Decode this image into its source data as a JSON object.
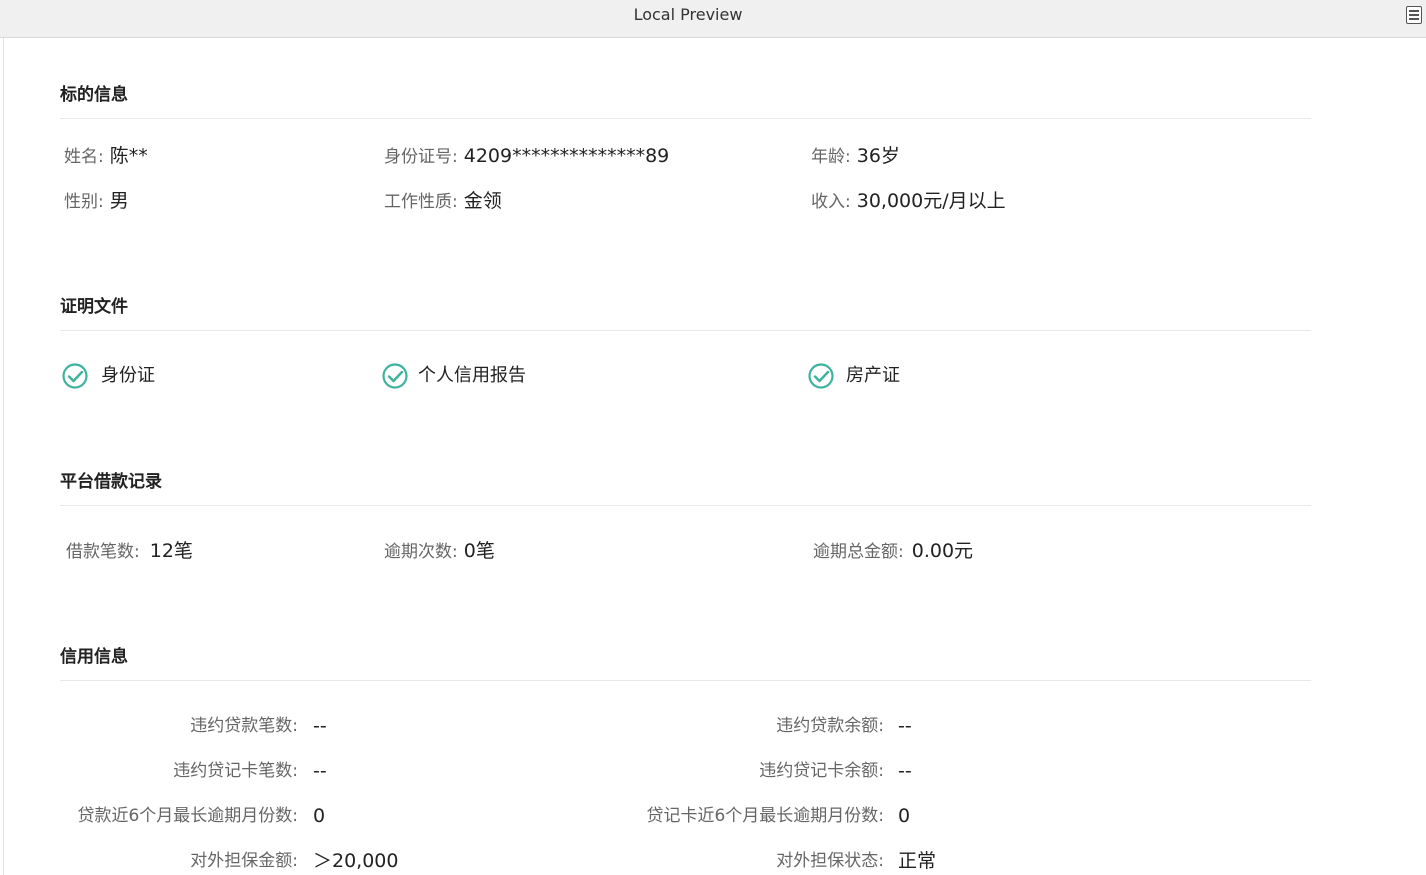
{
  "window": {
    "title": "Local Preview",
    "menu_icon": "document-menu-icon"
  },
  "sections": {
    "target_info": {
      "title": "标的信息",
      "fields": [
        {
          "label": "姓名:",
          "value": "陈**"
        },
        {
          "label": "身份证号:",
          "value": "4209**************89"
        },
        {
          "label": "年龄:",
          "value": "36岁"
        },
        {
          "label": "性别:",
          "value": "男"
        },
        {
          "label": "工作性质:",
          "value": "金领"
        },
        {
          "label": "收入:",
          "value": "30,000元/月以上"
        }
      ]
    },
    "documents": {
      "title": "证明文件",
      "items": [
        {
          "label": "身份证",
          "icon": "check-circle-icon"
        },
        {
          "label": "个人信用报告",
          "icon": "check-circle-icon"
        },
        {
          "label": "房产证",
          "icon": "check-circle-icon"
        }
      ],
      "check_color": "#3db39e"
    },
    "loan_record": {
      "title": "平台借款记录",
      "fields": [
        {
          "label": "借款笔数:",
          "value": "12笔"
        },
        {
          "label": "逾期次数:",
          "value": "0笔"
        },
        {
          "label": "逾期总金额:",
          "value": "0.00元"
        }
      ]
    },
    "credit_info": {
      "title": "信用信息",
      "fields": [
        {
          "label": "违约贷款笔数:",
          "value": "--"
        },
        {
          "label": "违约贷款余额:",
          "value": "--"
        },
        {
          "label": "违约贷记卡笔数:",
          "value": "--"
        },
        {
          "label": "违约贷记卡余额:",
          "value": "--"
        },
        {
          "label": "贷款近6个月最长逾期月份数:",
          "value": "0"
        },
        {
          "label": "贷记卡近6个月最长逾期月份数:",
          "value": "0"
        },
        {
          "label": "对外担保金额:",
          "value": "＞20,000"
        },
        {
          "label": "对外担保状态:",
          "value": "正常"
        }
      ]
    }
  }
}
